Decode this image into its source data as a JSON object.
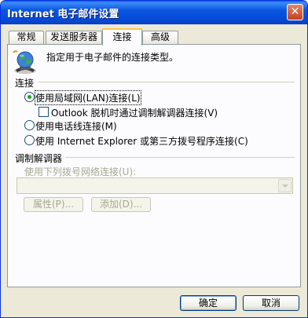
{
  "window": {
    "title": "Internet 电子邮件设置",
    "close_glyph": "✕"
  },
  "tabs": [
    {
      "label": "常规"
    },
    {
      "label": "发送服务器"
    },
    {
      "label": "连接"
    },
    {
      "label": "高级"
    }
  ],
  "active_tab": "连接",
  "panel": {
    "intro_icon": "connection-globe-icon",
    "intro_text": "指定用于电子邮件的连接类型。",
    "connection_group": "连接",
    "options": {
      "lan": "使用局域网(LAN)连接(L)",
      "modem_offline": "Outlook 脱机时通过调制解调器连接(V)",
      "phone": "使用电话线连接(M)",
      "ie_dialer": "使用 Internet Explorer 或第三方拨号程序连接(C)"
    },
    "selected_option": "lan",
    "modem_offline_checked": false,
    "modem_group": "调制解调器",
    "dialup_label": "使用下列拨号网络连接(U):",
    "dialup_value": "",
    "properties_btn": "属性(P)...",
    "add_btn": "添加(D)..."
  },
  "footer": {
    "ok": "确定",
    "cancel": "取消"
  },
  "colors": {
    "title_bar": "#0A56E0",
    "tab_highlight": "#FFC83C",
    "radio_dot": "#21A121",
    "disabled_text": "#A7A692",
    "dialog_bg": "#ECE9D8"
  }
}
